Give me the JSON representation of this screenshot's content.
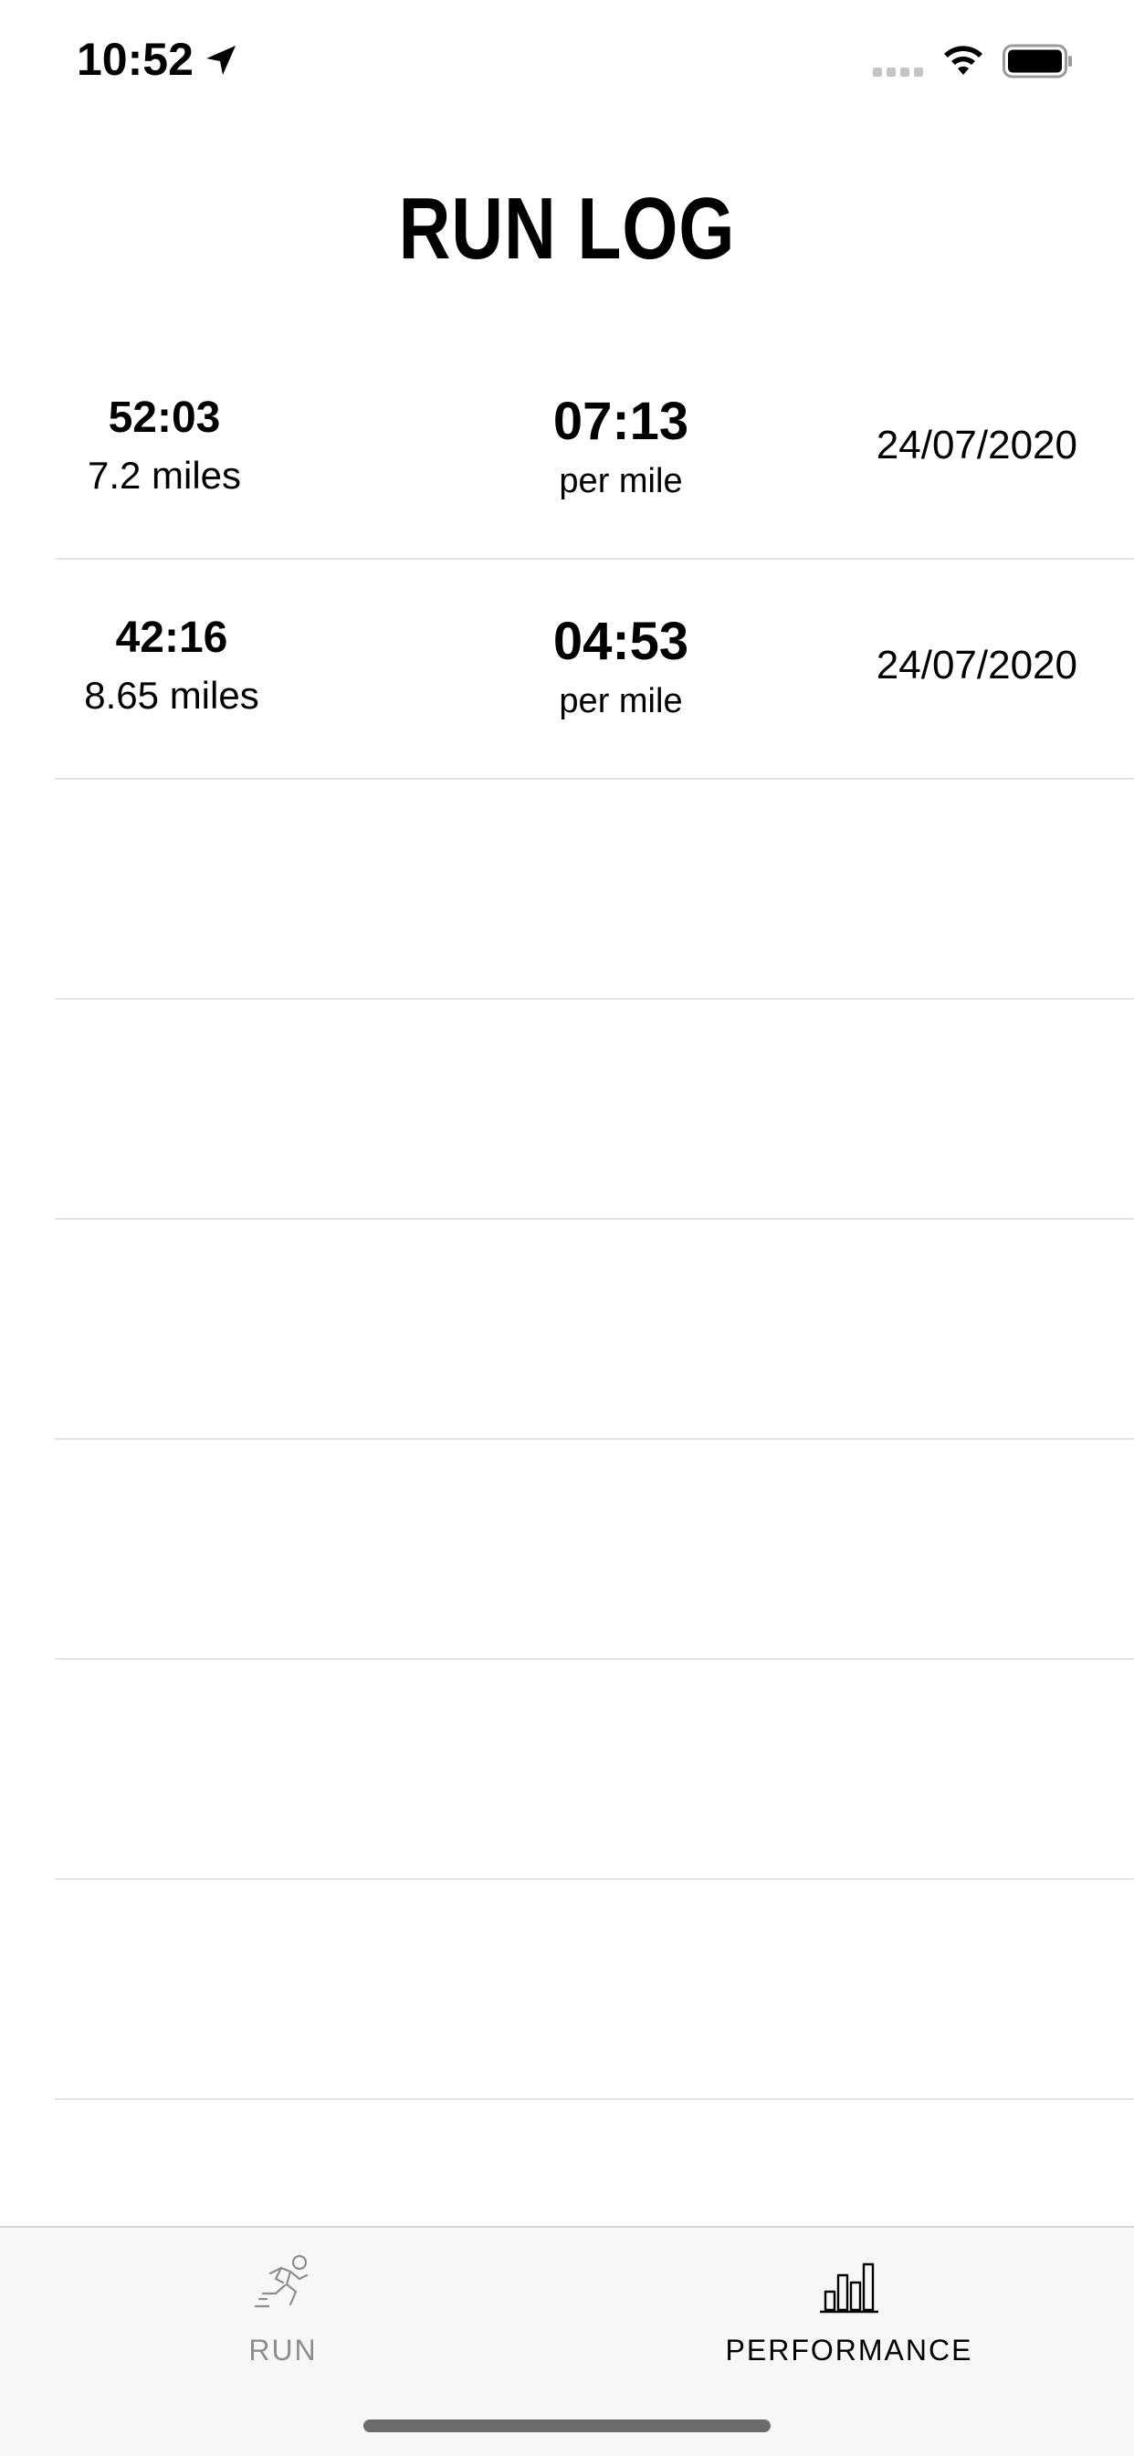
{
  "status_bar": {
    "time": "10:52"
  },
  "page": {
    "title": "RUN LOG"
  },
  "runs": [
    {
      "duration": "52:03",
      "distance": "7.2 miles",
      "pace": "07:13",
      "pace_unit": "per mile",
      "date": "24/07/2020"
    },
    {
      "duration": "42:16",
      "distance": "8.65 miles",
      "pace": "04:53",
      "pace_unit": "per mile",
      "date": "24/07/2020"
    }
  ],
  "tabs": [
    {
      "label": "RUN",
      "icon": "runner-icon",
      "active": false
    },
    {
      "label": "PERFORMANCE",
      "icon": "bar-chart-icon",
      "active": true
    }
  ],
  "colors": {
    "divider": "#e3e3e3",
    "tab_bar_bg": "#f7f7f7",
    "inactive_tab": "#8e8e8e",
    "active_tab": "#000000"
  }
}
